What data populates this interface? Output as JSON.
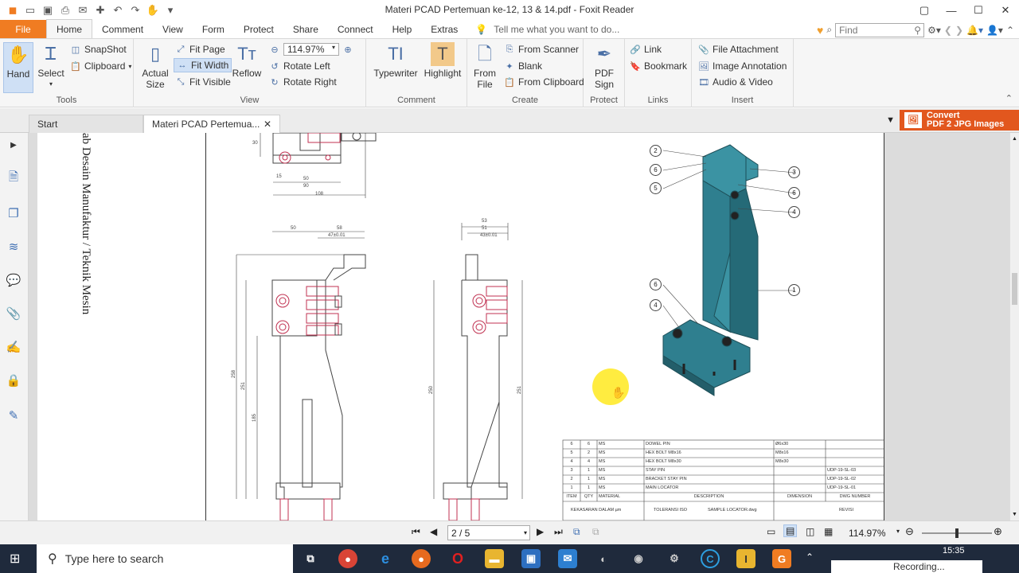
{
  "window": {
    "title": "Materi PCAD Pertemuan ke-12, 13 & 14.pdf - Foxit Reader",
    "controls": {
      "restore": "▢",
      "minimize": "—",
      "maximize": "☐",
      "close": "✕"
    }
  },
  "menu": {
    "file": "File",
    "tabs": [
      "Home",
      "Comment",
      "View",
      "Form",
      "Protect",
      "Share",
      "Connect",
      "Help",
      "Extras"
    ],
    "tell_me": "Tell me what you want to do...",
    "find_placeholder": "Find"
  },
  "ribbon": {
    "tools": {
      "label": "Tools",
      "hand": "Hand",
      "select": "Select",
      "snapshot": "SnapShot",
      "clipboard": "Clipboard"
    },
    "view": {
      "label": "View",
      "actual_size_1": "Actual",
      "actual_size_2": "Size",
      "fit_page": "Fit Page",
      "fit_width": "Fit Width",
      "fit_visible": "Fit Visible",
      "reflow": "Reflow",
      "zoom_value": "114.97%",
      "rotate_left": "Rotate Left",
      "rotate_right": "Rotate Right"
    },
    "comment": {
      "label": "Comment",
      "typewriter": "Typewriter",
      "highlight": "Highlight"
    },
    "create": {
      "label": "Create",
      "from_file_1": "From",
      "from_file_2": "File",
      "from_scanner": "From Scanner",
      "blank": "Blank",
      "from_clipboard": "From Clipboard"
    },
    "protect": {
      "label": "Protect",
      "pdf_sign_1": "PDF",
      "pdf_sign_2": "Sign"
    },
    "links": {
      "label": "Links",
      "link": "Link",
      "bookmark": "Bookmark"
    },
    "insert": {
      "label": "Insert",
      "file_attachment": "File Attachment",
      "image_annotation": "Image Annotation",
      "audio_video": "Audio & Video"
    }
  },
  "doc_tabs": {
    "start": "Start",
    "doc": "Materi PCAD Pertemua...",
    "convert_1": "Convert",
    "convert_2": "PDF 2 JPG Images"
  },
  "page_content": {
    "side_text": "ab Desain Manufaktur / Teknik Mesin",
    "dims": {
      "d50a": "50",
      "d90": "90",
      "d108": "108",
      "d50b": "50",
      "d58": "58",
      "d47a": "47±0.01",
      "d53": "53",
      "d51": "51",
      "d43": "43±0.01",
      "d258": "258",
      "d251": "251",
      "d185": "185",
      "d250": "250",
      "d251b": "251",
      "d15": "15",
      "d30": "30"
    },
    "balloons": [
      "2",
      "6",
      "5",
      "3",
      "6",
      "4",
      "1",
      "6",
      "4"
    ],
    "bom": {
      "rows": [
        [
          "6",
          "6",
          "MS",
          "DOWEL PIN",
          "Ø6x30",
          ""
        ],
        [
          "5",
          "2",
          "MS",
          "HEX BOLT M8x16",
          "M8x16",
          ""
        ],
        [
          "4",
          "4",
          "MS",
          "HEX BOLT M8x30",
          "M8x30",
          ""
        ],
        [
          "3",
          "1",
          "MS",
          "STAY PIN",
          "",
          "UDP-19-SL-03"
        ],
        [
          "2",
          "1",
          "MS",
          "BRACKET STAY PIN",
          "",
          "UDP-19-SL-02"
        ],
        [
          "1",
          "1",
          "MS",
          "MAIN LOCATOR",
          "",
          "UDP-19-SL-01"
        ]
      ],
      "header": [
        "ITEM",
        "QTY",
        "MATERIAL",
        "DESCRIPTION",
        "DIMENSION",
        "DWG NUMBER"
      ],
      "foot1": "KEKASARAN DALAM µm",
      "foot2": "TOLERANSI ISO",
      "foot3": "SAMPLE LOCATOR.dwg",
      "foot4": "REVISI"
    }
  },
  "status": {
    "page_value": "2 / 5",
    "zoom": "114.97%"
  },
  "taskbar": {
    "search_placeholder": "Type here to search",
    "time": "15:35",
    "recording": "Recording..."
  },
  "colors": {
    "accent_orange": "#f07c22",
    "part_teal": "#2f7f8f",
    "convert_red": "#e2571e",
    "taskbar": "#1f2a3c"
  }
}
